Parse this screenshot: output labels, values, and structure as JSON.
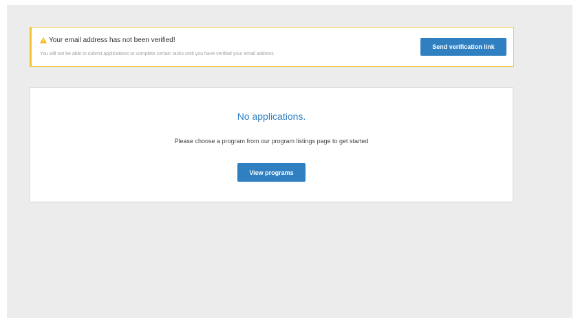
{
  "alert": {
    "title": "Your email address has not been verified!",
    "message": "You will not be able to submit applications or complete certain tasks until you have verified your email address",
    "button_label": "Send verification link",
    "icon": "warning-icon",
    "accent_color": "#f2c43a"
  },
  "empty_state": {
    "title": "No applications.",
    "message": "Please choose a program from our program listings page to get started",
    "button_label": "View programs"
  },
  "colors": {
    "primary": "#2f7fc1",
    "page_background": "#ececec"
  }
}
